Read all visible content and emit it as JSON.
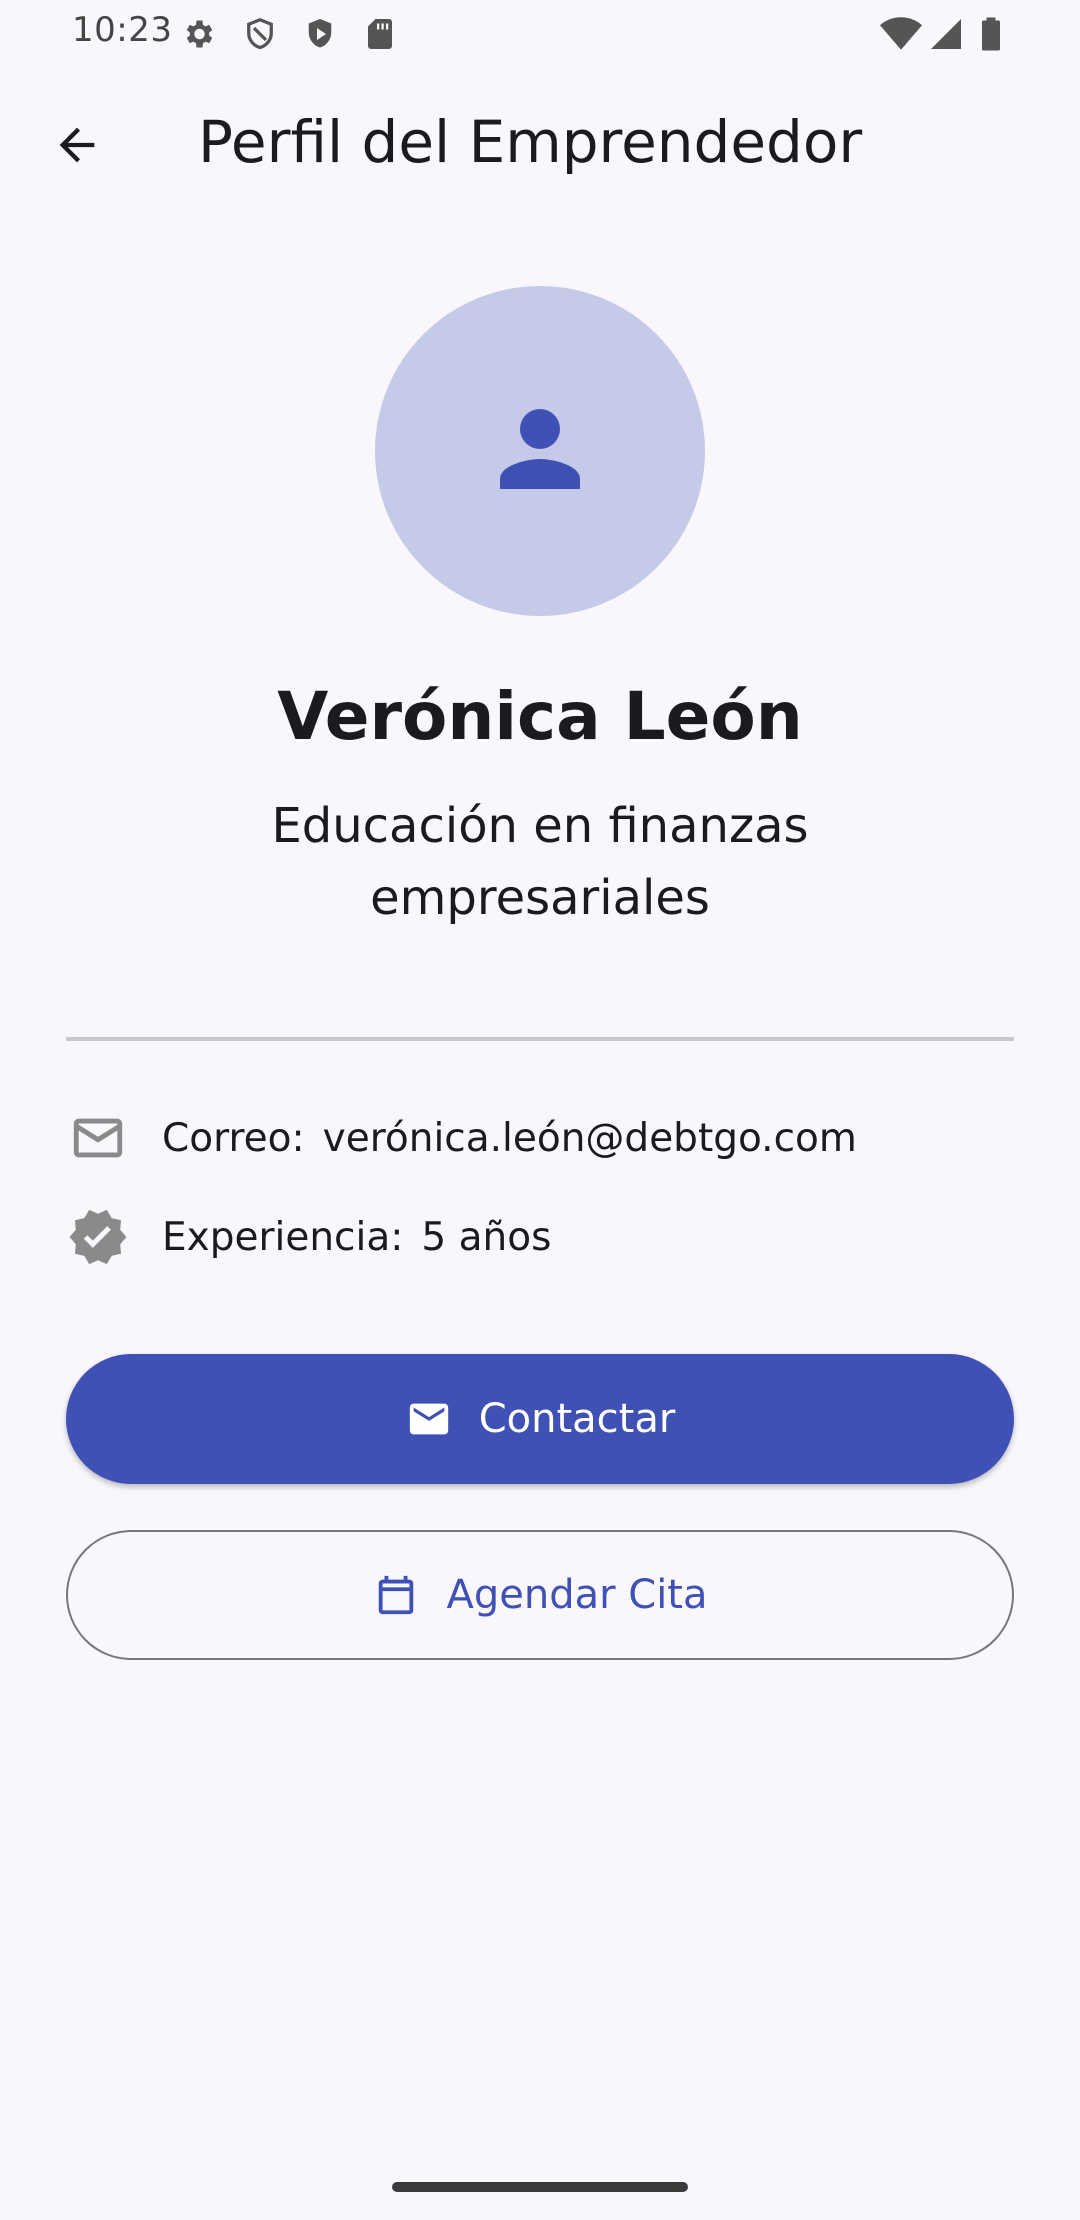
{
  "status_bar": {
    "time": "10:23",
    "icons": [
      "settings-icon",
      "shield-icon",
      "play-protect-icon",
      "sd-card-icon",
      "wifi-icon",
      "signal-icon",
      "battery-icon"
    ]
  },
  "app_bar": {
    "title": "Perfil del Emprendedor",
    "back_icon": "arrow-back-icon"
  },
  "profile": {
    "avatar_icon": "person-icon",
    "name": "Verónica León",
    "specialty": "Educación en finanzas empresariales"
  },
  "details": {
    "email_label": "Correo:",
    "email_value": "verónica.león@debtgo.com",
    "experience_label": "Experiencia:",
    "experience_value": "5 años"
  },
  "actions": {
    "contact_label": "Contactar",
    "schedule_label": "Agendar Cita"
  },
  "colors": {
    "background": "#f9f7fc",
    "primary": "#3f51b5",
    "avatar_background": "#c5cae9",
    "on_primary": "#ffffff",
    "icon_gray": "#8a8a8a"
  }
}
